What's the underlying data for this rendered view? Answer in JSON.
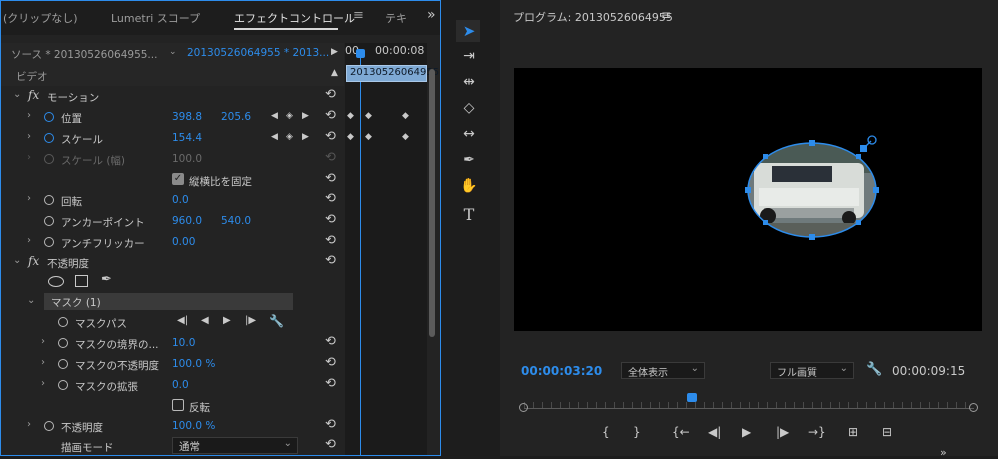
{
  "tabs": {
    "clip": "(クリップなし)",
    "lumetri": "Lumetri スコープ",
    "effect_controls": "エフェクトコントロール",
    "tab_menu": "≡",
    "text": "テキ",
    "overflow": "»"
  },
  "source": {
    "label": "ソース * 20130526064955...",
    "sequence": "20130526064955 * 2013...",
    "time_start": "00",
    "time_end": "00:00:08",
    "clip_name": "20130526064955"
  },
  "section": {
    "video": "ビデオ"
  },
  "motion": {
    "title": "モーション",
    "position": {
      "label": "位置",
      "x": "398.8",
      "y": "205.6"
    },
    "scale": {
      "label": "スケール",
      "value": "154.4"
    },
    "scale_width": {
      "label": "スケール (幅)",
      "value": "100.0"
    },
    "uniform_scale": "縦横比を固定",
    "rotation": {
      "label": "回転",
      "value": "0.0"
    },
    "anchor": {
      "label": "アンカーポイント",
      "x": "960.0",
      "y": "540.0"
    },
    "antiflicker": {
      "label": "アンチフリッカー",
      "value": "0.00"
    }
  },
  "opacity": {
    "title": "不透明度",
    "mask": "マスク (1)",
    "mask_path": "マスクパス",
    "mask_feather": {
      "label": "マスクの境界の...",
      "value": "10.0"
    },
    "mask_opacity": {
      "label": "マスクの不透明度",
      "value": "100.0 %"
    },
    "mask_expansion": {
      "label": "マスクの拡張",
      "value": "0.0"
    },
    "inverted": "反転",
    "opacity": {
      "label": "不透明度",
      "value": "100.0 %"
    },
    "blend_mode": {
      "label": "描画モード",
      "value": "通常"
    }
  },
  "program": {
    "title": "プログラム: 20130526064955",
    "menu": "≡",
    "current_time": "00:00:03:20",
    "zoom": "全体表示",
    "quality": "フル画質",
    "duration": "00:00:09:15"
  },
  "colors": {
    "accent": "#2d8ceb",
    "panel": "#232323",
    "video_bg": "#000000"
  },
  "icons": [
    "selection-tool-icon",
    "track-select-icon",
    "ripple-edit-icon",
    "razor-icon",
    "slip-icon",
    "pen-icon",
    "hand-icon",
    "type-icon",
    "stopwatch-icon",
    "reset-icon",
    "wrench-icon",
    "play-icon"
  ]
}
